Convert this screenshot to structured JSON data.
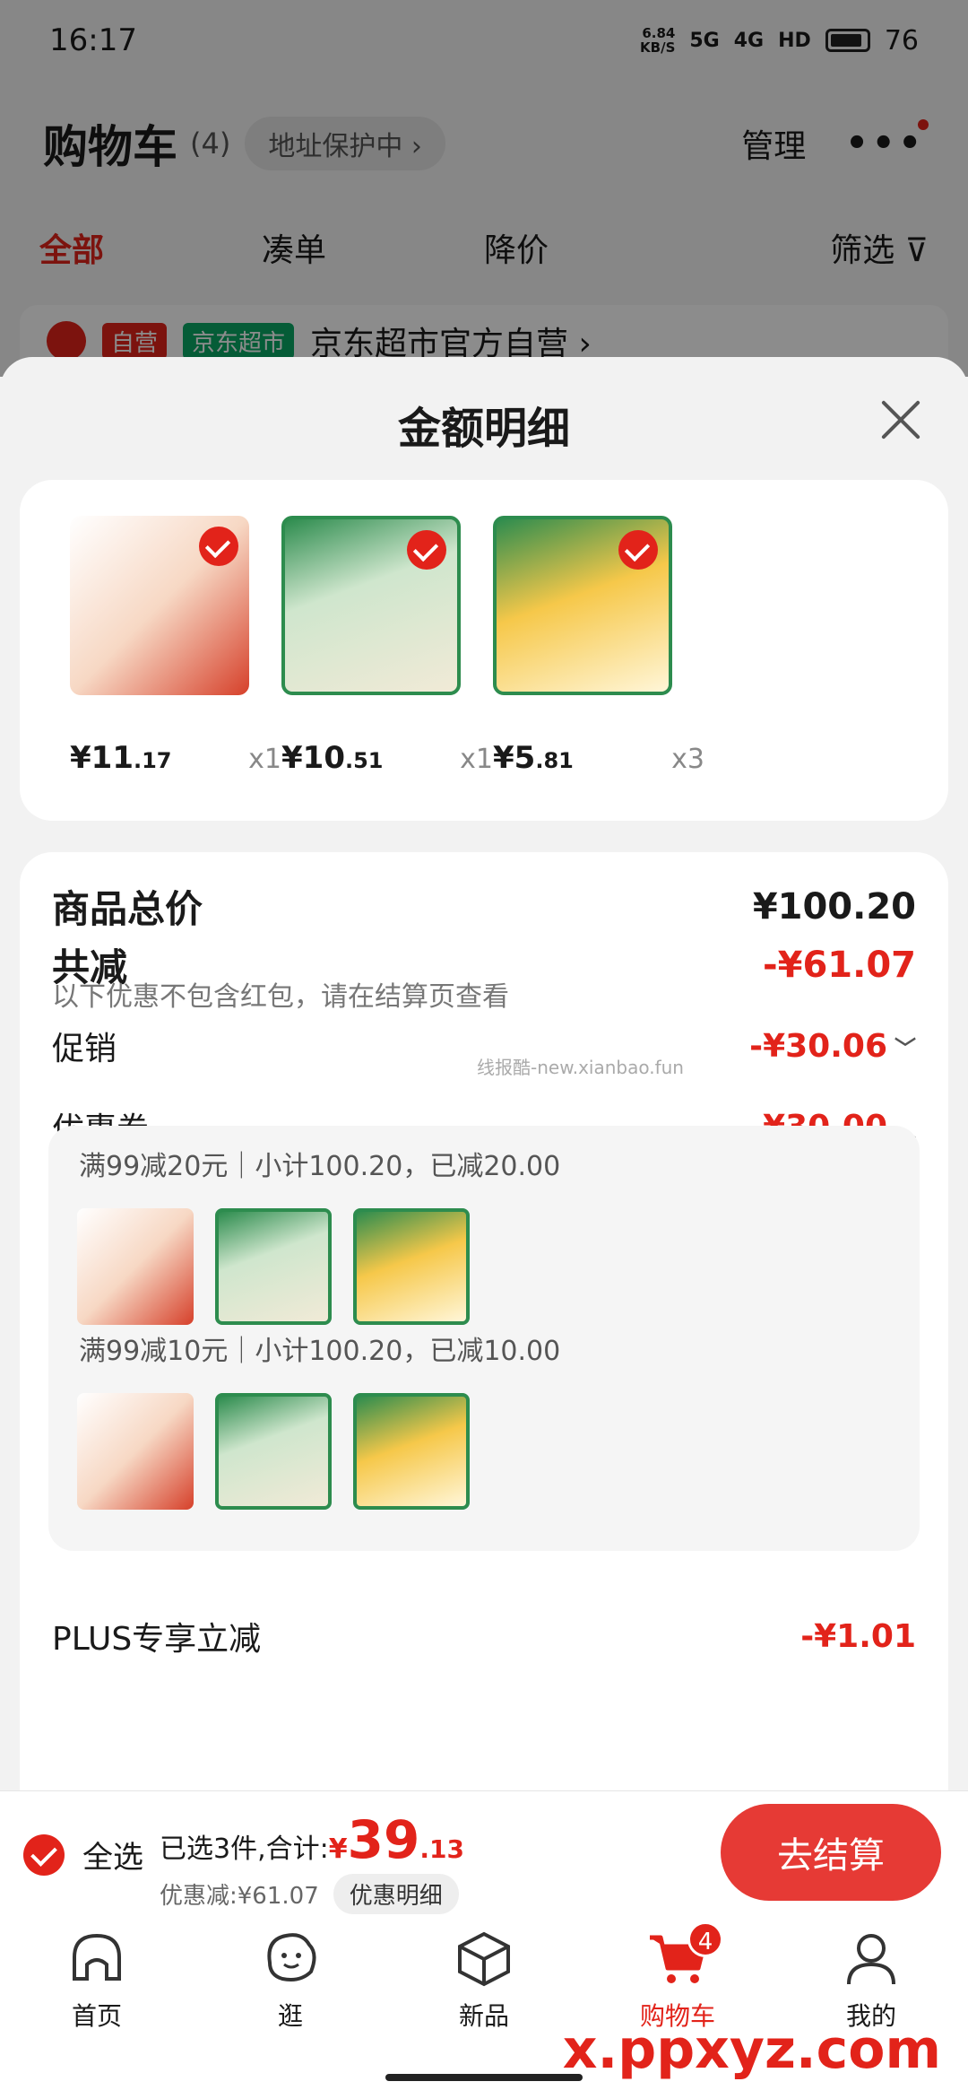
{
  "status_bar": {
    "time": "16:17",
    "net_speed": "6.84\nKB/S",
    "signal1": "5G",
    "signal2": "4G",
    "hd": "HD",
    "battery": "76"
  },
  "cart": {
    "title": "购物车",
    "count": "(4)",
    "address": "地址保护中 ›",
    "manage": "管理",
    "tabs": [
      "全部",
      "凑单",
      "降价",
      "筛选"
    ],
    "store_tag_self": "自营",
    "store_tag_market": "京东超市",
    "store_name": "京东超市官方自营 ›"
  },
  "modal": {
    "title": "金额明细",
    "products": [
      {
        "price_int": "¥11",
        "price_dec": ".17",
        "qty": "x1"
      },
      {
        "price_int": "¥10",
        "price_dec": ".51",
        "qty": "x1"
      },
      {
        "price_int": "¥5",
        "price_dec": ".81",
        "qty": "x3"
      }
    ],
    "total_label": "商品总价",
    "total_value": "¥100.20",
    "discount_label": "共减",
    "discount_value": "-¥61.07",
    "discount_note": "以下优惠不包含红包，请在结算页查看",
    "promo_label": "促销",
    "promo_value": "-¥30.06",
    "coupon_label": "优惠券",
    "coupon_value": "-¥30.00",
    "coupons": [
      {
        "title": "满99减20元｜小计100.20，已减20.00"
      },
      {
        "title": "满99减10元｜小计100.20，已减10.00"
      }
    ],
    "plus_label": "PLUS专享立减",
    "plus_value": "-¥1.01",
    "watermark": "线报酷-new.xianbao.fun"
  },
  "footer": {
    "select_all": "全选",
    "selected_text": "已选3件,合计:",
    "total_currency": "¥",
    "total_int": "39",
    "total_dec": ".13",
    "discount_summary": "优惠减:¥61.07",
    "detail_button": "优惠明细",
    "checkout": "去结算"
  },
  "nav": {
    "items": [
      "首页",
      "逛",
      "新品",
      "购物车",
      "我的"
    ],
    "cart_badge": "4"
  },
  "site_watermark": "x.ppxyz.com",
  "colors": {
    "accent": "#e2231a",
    "green": "#2d8c4e"
  }
}
